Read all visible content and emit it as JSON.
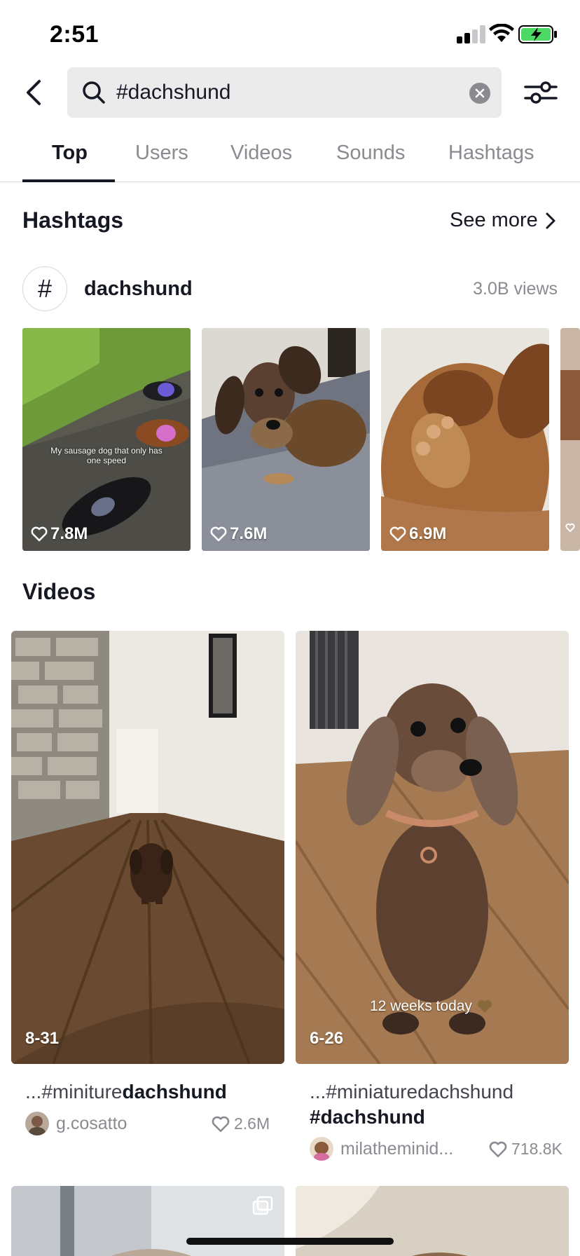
{
  "status_bar": {
    "time": "2:51"
  },
  "search": {
    "query": "#dachshund"
  },
  "tabs": [
    {
      "label": "Top",
      "active": true
    },
    {
      "label": "Users",
      "active": false
    },
    {
      "label": "Videos",
      "active": false
    },
    {
      "label": "Sounds",
      "active": false
    },
    {
      "label": "Hashtags",
      "active": false
    }
  ],
  "hashtags_section": {
    "title": "Hashtags",
    "see_more": "See more",
    "tag": {
      "name": "dachshund",
      "views": "3.0B views"
    },
    "thumbnails": [
      {
        "likes": "7.8M",
        "caption": "My sausage dog that only has one speed"
      },
      {
        "likes": "7.6M"
      },
      {
        "likes": "6.9M"
      }
    ]
  },
  "videos_section": {
    "title": "Videos",
    "items": [
      {
        "date": "8-31",
        "desc_muted": "...#miniture",
        "desc_bold": "dachshund",
        "user": "g.cosatto",
        "likes": "2.6M"
      },
      {
        "date": "6-26",
        "overlay": "12 weeks today",
        "desc_muted": "...#miniaturedachshund",
        "desc_bold": "#dachshund",
        "user": "milatheminid...",
        "likes": "718.8K"
      }
    ]
  },
  "colors": {
    "text_primary": "#161823",
    "text_secondary": "#8a8b91",
    "search_bg": "#ebebec",
    "battery_green": "#4cd964"
  },
  "icons": [
    "back-chevron-icon",
    "search-icon",
    "clear-icon",
    "filter-sliders-icon",
    "chevron-right-icon",
    "hashtag-icon",
    "heart-icon",
    "multi-photo-icon"
  ]
}
